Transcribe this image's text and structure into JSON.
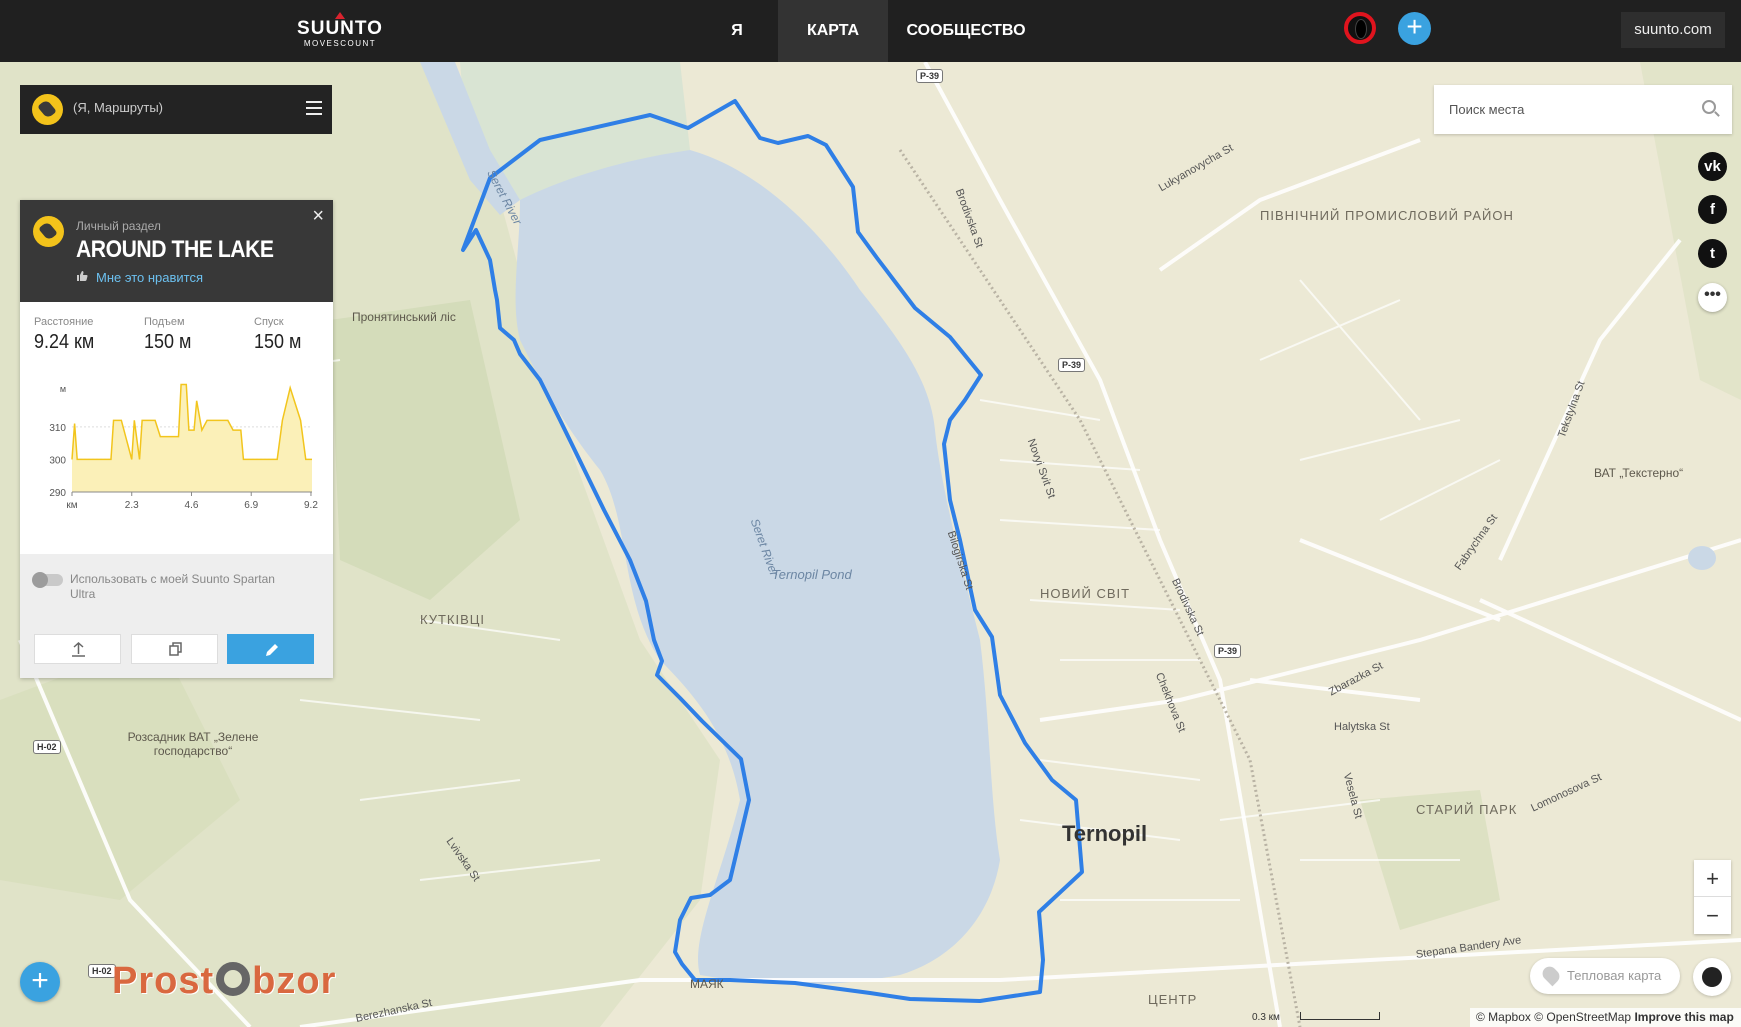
{
  "header": {
    "logo_brand": "SUUNTO",
    "logo_sub": "MOVESCOUNT",
    "nav": [
      {
        "label": "Я",
        "active": false
      },
      {
        "label": "КАРТА",
        "active": true
      },
      {
        "label": "СООБЩЕСТВО",
        "active": false
      }
    ],
    "add_label": "+",
    "site_link": "suunto.com"
  },
  "breadcrumb": {
    "text": "(Я, Маршруты)"
  },
  "route": {
    "section": "Личный раздел",
    "title": "AROUND THE LAKE",
    "like_label": "Мне это нравится",
    "close_label": "×",
    "stats": [
      {
        "label": "Расстояние",
        "value": "9.24 км"
      },
      {
        "label": "Подъем",
        "value": "150 м"
      },
      {
        "label": "Спуск",
        "value": "150 м"
      }
    ],
    "device_toggle_label": "Использовать с моей Suunto Spartan Ultra",
    "device_toggle_on": false
  },
  "chart_data": {
    "type": "area",
    "title": "",
    "ylabel": "м",
    "xlabel": "км",
    "y_ticks": [
      290,
      300,
      310
    ],
    "x_ticks": [
      2.3,
      4.6,
      6.9,
      9.2
    ],
    "x_tick_labels": [
      "км",
      "2.3",
      "4.6",
      "6.9",
      "9.2"
    ],
    "xlim": [
      0,
      9.24
    ],
    "ylim": [
      290,
      325
    ],
    "x": [
      0,
      0.1,
      0.2,
      1.5,
      1.6,
      1.9,
      2.3,
      2.4,
      2.6,
      2.7,
      3.2,
      3.4,
      3.6,
      4.1,
      4.2,
      4.4,
      4.5,
      4.7,
      4.8,
      5.0,
      5.2,
      6.0,
      6.2,
      6.5,
      6.6,
      7.4,
      7.9,
      8.1,
      8.4,
      8.8,
      9.0,
      9.24
    ],
    "y": [
      300,
      311,
      300,
      300,
      312,
      312,
      300,
      312,
      300,
      312,
      312,
      307,
      307,
      307,
      323,
      323,
      309,
      309,
      318,
      309,
      312,
      312,
      309,
      309,
      300,
      300,
      300,
      312,
      322,
      312,
      300,
      300
    ],
    "colors": {
      "fill": "#fbf0b8",
      "line": "#f2c51d"
    }
  },
  "search": {
    "placeholder": "Поиск места"
  },
  "social": [
    "vk-icon",
    "facebook-icon",
    "twitter-icon",
    "more-icon"
  ],
  "social_glyphs": [
    "vk",
    "f",
    "t",
    "•••"
  ],
  "map_controls": {
    "zoom_in": "+",
    "zoom_out": "−",
    "heatmap_label": "Тепловая карта"
  },
  "map_labels": {
    "city": "Ternopil",
    "pond": "Ternopil Pond",
    "river1": "Seret River",
    "river2": "Seret River",
    "district_north": "ПІВНІЧНИЙ ПРОМИСЛОВИЙ РАЙОН",
    "district_new": "НОВИЙ СВІТ",
    "district_kutkivtsi": "КУТКІВЦІ",
    "park": "СТАРИЙ ПАРК",
    "center": "ЦЕНТР",
    "mayak": "МАЯК",
    "forest": "Пронятинський ліс",
    "nursery": "Розсадник ВАТ „Зелене господарство“",
    "factory": "ВАТ „Текстерно“",
    "streets": [
      "Brodivska St",
      "Lukyanovycha St",
      "Novyi Svit St",
      "Brodivska St",
      "Chekhova St",
      "Zbarazka St",
      "Halytska St",
      "Fabrychna St",
      "Tekstylna St",
      "Lvivska St",
      "Berezhanska St",
      "Stepana Bandery Ave",
      "Lomonosova St",
      "Vesela St",
      "Bilogirska St"
    ],
    "road_shields": [
      "P-39",
      "P-39",
      "P-39",
      "H-02",
      "H-02"
    ]
  },
  "watermark": {
    "left": "Prost",
    "right": "bzor"
  },
  "scale_label": "0.3 км",
  "attribution": {
    "mapbox": "© Mapbox",
    "osm": "© OpenStreetMap",
    "improve": "Improve this map"
  },
  "colors": {
    "route": "#2f7fe6",
    "water": "#cad8e6",
    "accent": "#3aa2e0",
    "badge": "#f3c31b"
  }
}
